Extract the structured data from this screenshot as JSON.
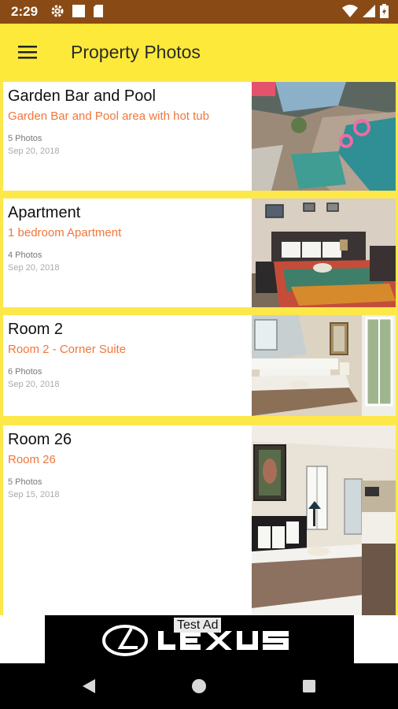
{
  "status_bar": {
    "time": "2:29",
    "icons": [
      "gear-icon",
      "square-icon",
      "sd-card-icon",
      "wifi-icon",
      "signal-icon",
      "battery-icon"
    ]
  },
  "app_bar": {
    "title": "Property Photos",
    "menu_icon": "hamburger-menu-icon"
  },
  "properties": [
    {
      "title": "Garden Bar and Pool",
      "subtitle": "Garden Bar and Pool area with hot tub",
      "photos": "5 Photos",
      "date": "Sep 20, 2018",
      "image": "pool-photo"
    },
    {
      "title": "Apartment",
      "subtitle": "1 bedroom Apartment",
      "photos": "4 Photos",
      "date": "Sep 20, 2018",
      "image": "apartment-bedroom-photo"
    },
    {
      "title": "Room 2",
      "subtitle": "Room 2 - Corner Suite",
      "photos": "6 Photos",
      "date": "Sep 20, 2018",
      "image": "room-2-photo"
    },
    {
      "title": "Room 26",
      "subtitle": "Room 26",
      "photos": "5 Photos",
      "date": "Sep 15, 2018",
      "image": "room-26-photo"
    }
  ],
  "ad": {
    "label": "Test Ad",
    "brand_logo": "lexus-logo"
  },
  "colors": {
    "status_bar": "#8a4a16",
    "app_bar": "#fde93a",
    "subtitle": "#f0773a"
  },
  "nav_bar": {
    "buttons": [
      "back-icon",
      "home-icon",
      "recents-icon"
    ]
  }
}
